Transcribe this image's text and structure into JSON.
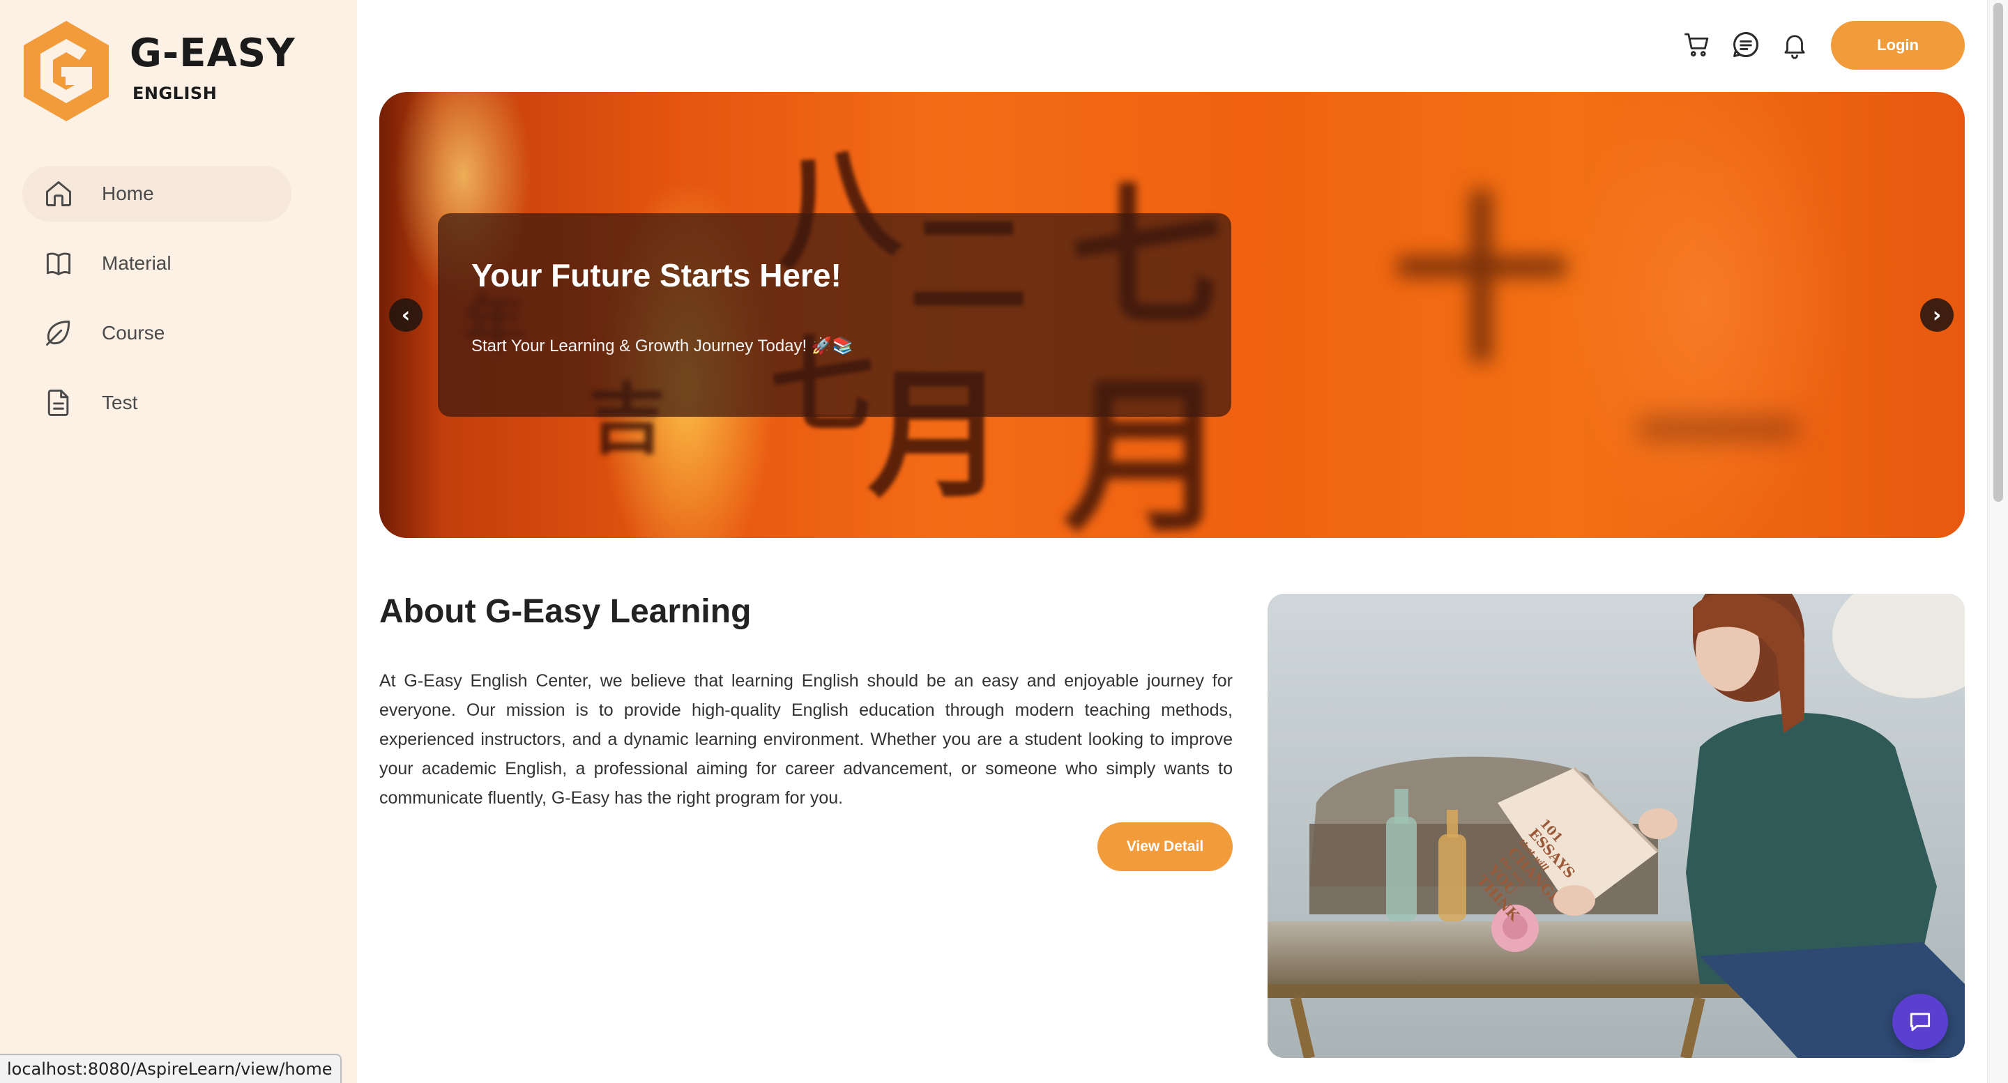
{
  "sidebar": {
    "brand": "G-EASY",
    "brand_sub": "ENGLISH",
    "items": [
      {
        "label": "Home",
        "icon": "home-icon",
        "active": true
      },
      {
        "label": "Material",
        "icon": "book-icon",
        "active": false
      },
      {
        "label": "Course",
        "icon": "leaf-icon",
        "active": false
      },
      {
        "label": "Test",
        "icon": "document-icon",
        "active": false
      }
    ]
  },
  "header": {
    "icons": [
      "cart-icon",
      "message-icon",
      "bell-icon"
    ],
    "login_label": "Login"
  },
  "hero": {
    "title": "Your Future Starts Here!",
    "subtitle": "Start Your Learning & Growth Journey Today! 🚀📚",
    "prev_label": "‹",
    "next_label": "›"
  },
  "about": {
    "title": "About G-Easy Learning",
    "body": "At G-Easy English Center, we believe that learning English should be an easy and enjoyable journey for everyone. Our mission is to provide high-quality English education through modern teaching methods, experienced instructors, and a dynamic learning environment. Whether you are a student looking to improve your academic English, a professional aiming for career advancement, or someone who simply wants to communicate fluently, G-Easy has the right program for you.",
    "button_label": "View Detail",
    "book_lines": [
      "101",
      "ESSAYS",
      "that will",
      "CHANGE",
      "the way",
      "YOU",
      "THINK"
    ]
  },
  "status_bar": {
    "url": "localhost:8080/AspireLearn/view/home"
  },
  "colors": {
    "accent": "#f19b3a",
    "sidebar_bg": "#fdf0e5",
    "chat": "#5a3fd1"
  }
}
